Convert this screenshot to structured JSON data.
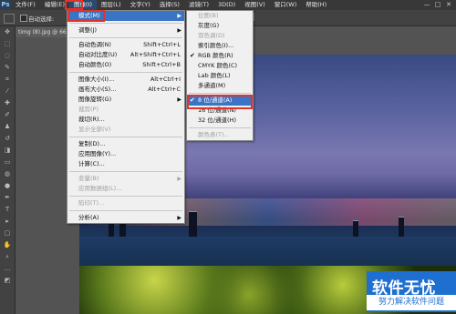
{
  "app": {
    "logo": "Ps"
  },
  "menubar": {
    "items": [
      {
        "label": "文件(F)"
      },
      {
        "label": "编辑(E)"
      },
      {
        "label": "图像(I)"
      },
      {
        "label": "图层(L)"
      },
      {
        "label": "文字(Y)"
      },
      {
        "label": "选择(S)"
      },
      {
        "label": "滤镜(T)"
      },
      {
        "label": "3D(D)"
      },
      {
        "label": "视图(V)"
      },
      {
        "label": "窗口(W)"
      },
      {
        "label": "帮助(H)"
      }
    ],
    "win_buttons": [
      "—",
      "□",
      "✕"
    ]
  },
  "options": {
    "auto_select_label": "自动选择:"
  },
  "document": {
    "tab": "timg (8).jpg @ 66"
  },
  "image_menu": {
    "items": [
      {
        "label": "模式(M)",
        "arrow": "▶",
        "highlight": true
      },
      {
        "sep": true
      },
      {
        "label": "调整(J)",
        "arrow": "▶"
      },
      {
        "sep": true
      },
      {
        "label": "自动色调(N)",
        "shortcut": "Shift+Ctrl+L"
      },
      {
        "label": "自动对比度(U)",
        "shortcut": "Alt+Shift+Ctrl+L"
      },
      {
        "label": "自动颜色(O)",
        "shortcut": "Shift+Ctrl+B"
      },
      {
        "sep": true
      },
      {
        "label": "图像大小(I)...",
        "shortcut": "Alt+Ctrl+I"
      },
      {
        "label": "画布大小(S)...",
        "shortcut": "Alt+Ctrl+C"
      },
      {
        "label": "图像旋转(G)",
        "arrow": "▶"
      },
      {
        "label": "裁剪(P)",
        "disabled": true
      },
      {
        "label": "裁切(R)..."
      },
      {
        "label": "显示全部(V)",
        "disabled": true
      },
      {
        "sep": true
      },
      {
        "label": "复制(D)..."
      },
      {
        "label": "应用图像(Y)..."
      },
      {
        "label": "计算(C)..."
      },
      {
        "sep": true
      },
      {
        "label": "变量(B)",
        "arrow": "▶",
        "disabled": true
      },
      {
        "label": "应用数据组(L)...",
        "disabled": true
      },
      {
        "sep": true
      },
      {
        "label": "陷印(T)...",
        "disabled": true
      },
      {
        "sep": true
      },
      {
        "label": "分析(A)",
        "arrow": "▶"
      }
    ]
  },
  "mode_menu": {
    "items": [
      {
        "label": "位图(B)",
        "disabled": true
      },
      {
        "label": "灰度(G)"
      },
      {
        "label": "双色调(D)",
        "disabled": true
      },
      {
        "label": "索引颜色(I)..."
      },
      {
        "label": "RGB 颜色(R)",
        "check": "✔"
      },
      {
        "label": "CMYK 颜色(C)"
      },
      {
        "label": "Lab 颜色(L)"
      },
      {
        "label": "多通道(M)"
      },
      {
        "sep": true
      },
      {
        "label": "8 位/通道(A)",
        "check": "✔",
        "highlight": true
      },
      {
        "label": "16 位/通道(N)"
      },
      {
        "label": "32 位/通道(H)"
      },
      {
        "sep": true
      },
      {
        "label": "颜色表(T)...",
        "disabled": true
      }
    ]
  },
  "watermark": {
    "title": "软件无忧",
    "subtitle": "努力解决软件问题"
  }
}
